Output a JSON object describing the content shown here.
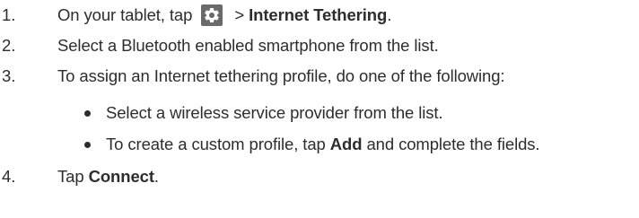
{
  "steps": [
    {
      "number": "1.",
      "prefix": "On your tablet, tap",
      "icon": "gear-icon",
      "middle": " > ",
      "bold": "Internet Tethering",
      "suffix": "."
    },
    {
      "number": "2.",
      "text": "Select a Bluetooth enabled smartphone from the list."
    },
    {
      "number": "3.",
      "text": "To assign an Internet tethering profile, do one of the following:",
      "bullets": [
        {
          "text": "Select a wireless service provider from the list."
        },
        {
          "prefix": "To create a custom profile, tap ",
          "bold": "Add",
          "suffix": " and complete the fields."
        }
      ]
    },
    {
      "number": "4.",
      "prefix": "Tap ",
      "bold": "Connect",
      "suffix": "."
    }
  ],
  "colors": {
    "text": "#2d2d2d",
    "icon_background": "#6a6a6a",
    "icon_foreground": "#ffffff"
  }
}
